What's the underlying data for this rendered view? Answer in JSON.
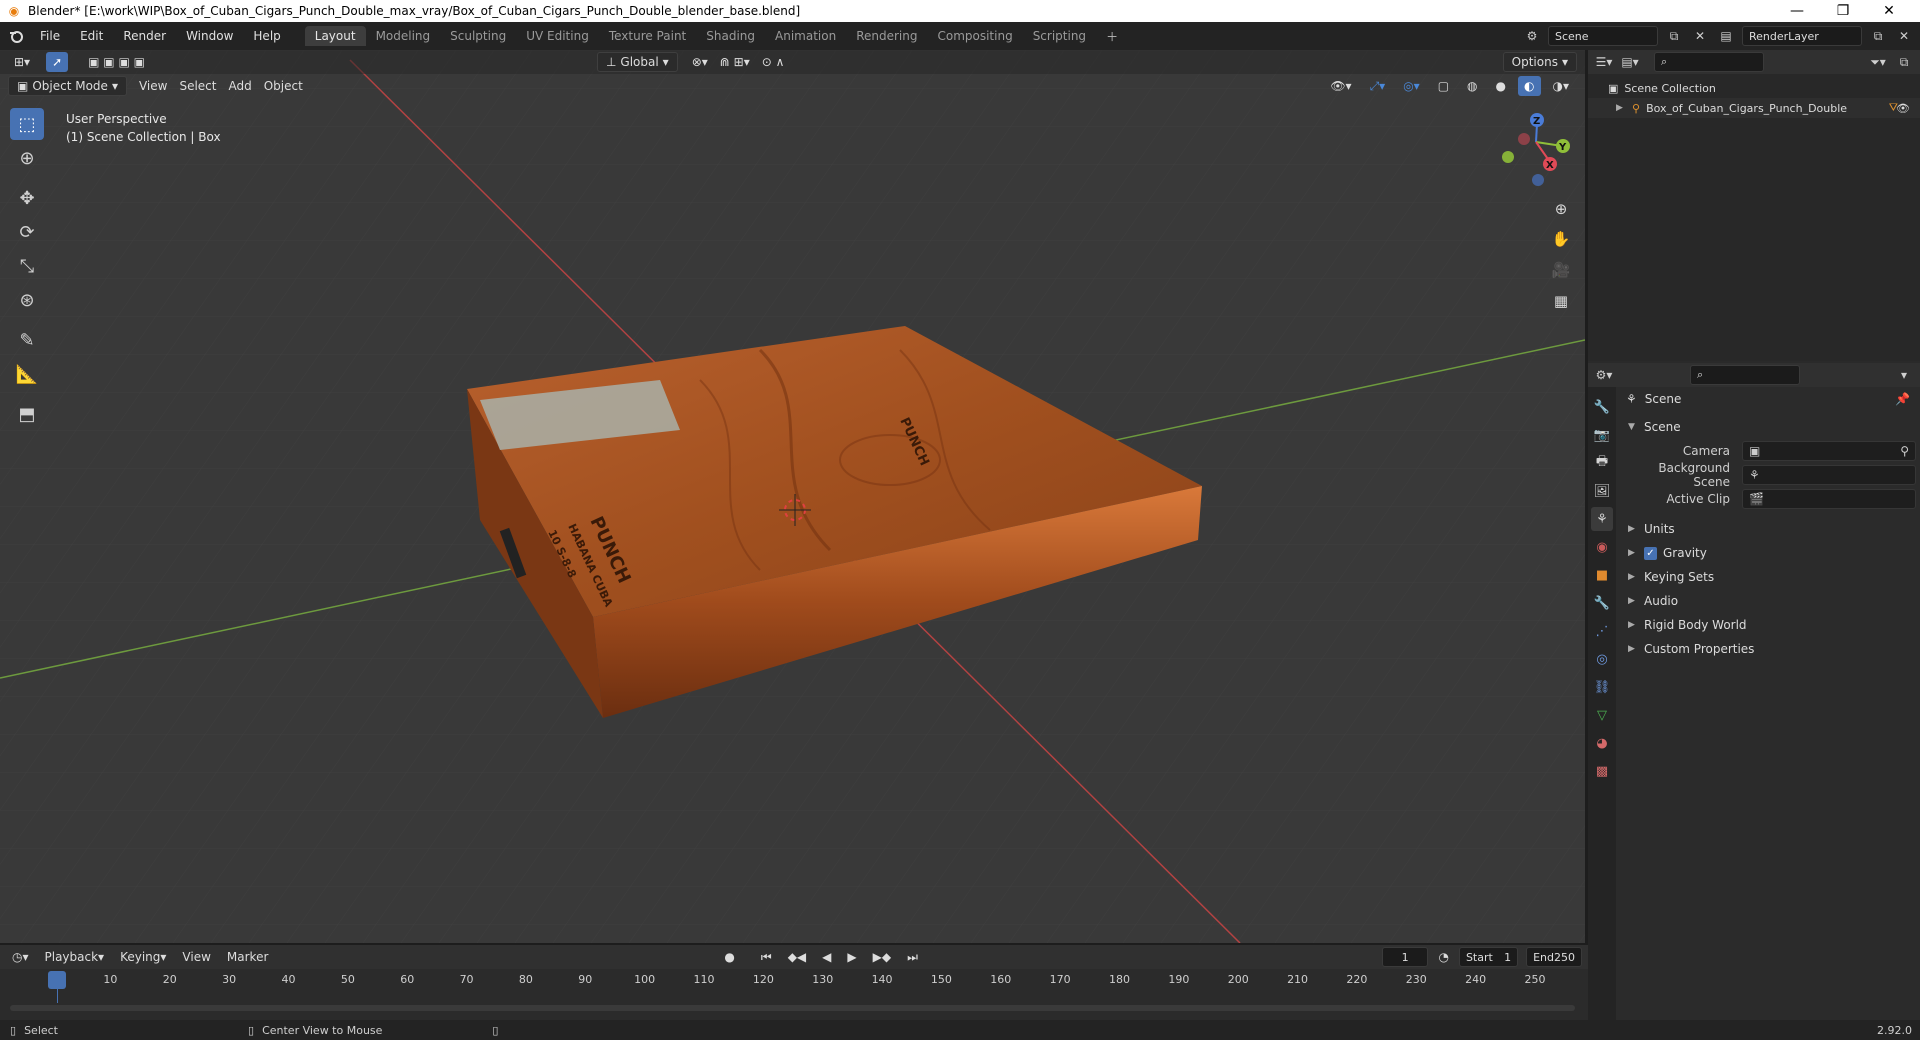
{
  "window": {
    "title": "Blender* [E:\\work\\WIP\\Box_of_Cuban_Cigars_Punch_Double_max_vray/Box_of_Cuban_Cigars_Punch_Double_blender_base.blend]",
    "minimize": "—",
    "restore": "❐",
    "close": "✕"
  },
  "menu": [
    "File",
    "Edit",
    "Render",
    "Window",
    "Help"
  ],
  "workspaces": [
    "Layout",
    "Modeling",
    "Sculpting",
    "UV Editing",
    "Texture Paint",
    "Shading",
    "Animation",
    "Rendering",
    "Compositing",
    "Scripting"
  ],
  "active_workspace": "Layout",
  "scene_selector": {
    "value": "Scene"
  },
  "render_layer": {
    "value": "RenderLayer"
  },
  "viewport": {
    "transform_orientation": "Global",
    "options_label": "Options",
    "mode": "Object Mode",
    "header_menus": [
      "View",
      "Select",
      "Add",
      "Object"
    ],
    "info_line1": "User Perspective",
    "info_line2": "(1) Scene Collection | Box",
    "gizmo": {
      "z": "Z",
      "y": "Y",
      "x": "X"
    }
  },
  "outliner": {
    "root": "Scene Collection",
    "items": [
      {
        "label": "Box_of_Cuban_Cigars_Punch_Double"
      }
    ]
  },
  "properties": {
    "context_title": "Scene",
    "panel_title": "Scene",
    "camera_label": "Camera",
    "background_scene_label": "Background Scene",
    "active_clip_label": "Active Clip",
    "subpanels": [
      "Units",
      "Gravity",
      "Keying Sets",
      "Audio",
      "Rigid Body World",
      "Custom Properties"
    ],
    "gravity_checked": true
  },
  "timeline": {
    "menus": [
      "Playback",
      "Keying",
      "View",
      "Marker"
    ],
    "current_frame": "1",
    "start_label": "Start",
    "start_value": "1",
    "end_label": "End",
    "end_value": "250",
    "ruler": [
      "1",
      "10",
      "20",
      "30",
      "40",
      "50",
      "60",
      "70",
      "80",
      "90",
      "100",
      "110",
      "120",
      "130",
      "140",
      "150",
      "160",
      "170",
      "180",
      "190",
      "200",
      "210",
      "220",
      "230",
      "240",
      "250"
    ]
  },
  "statusbar": {
    "select": "Select",
    "center_view": "Center View to Mouse",
    "version": "2.92.0"
  },
  "box_text": {
    "brand": "PUNCH",
    "origin": "HABANA CUBA",
    "count": "10 S-8-8"
  },
  "colors": {
    "accent": "#4772b3",
    "wood_dark": "#8a3f1a",
    "wood_light": "#c26a35",
    "axis_x": "#c03a3a",
    "axis_y": "#6fa03a"
  }
}
